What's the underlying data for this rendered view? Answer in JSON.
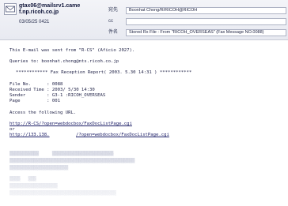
{
  "header": {
    "from_line1": "gtax06@mailsrv1.came",
    "from_line2": "f.np.ricoh.co.jp",
    "date": "03/05/25 0421",
    "to_label": "宛先",
    "to_value": "Boonhat Chong/R/RICOH@RICOH",
    "cc_label": "cc",
    "cc_value": "",
    "subject_label": "件名",
    "subject_value": "Stored Rx File : From \"RICOH_OVERSEAS\" (Fax Message NO.0088)"
  },
  "body": {
    "line1": "This E-mail was sent from \"R-CS\" (Aficio 2027).",
    "line2": "Queries to: boonhat.chong@nts.ricoh.co.jp",
    "report_header": "************ Fax Reception Report( 2003. 5.30 14:31 ) ************",
    "file_no": "File No.      : 0088",
    "received_time": "Received Time : 2003/ 5/30 14:30",
    "sender": "Sender        : G3-1 :RICOH_OVERSEAS",
    "page": "Page          : 001",
    "access": "Access the following URL.",
    "url1": "http://R-CS/?open=webdocbox/FaxDocListPage.cgi",
    "or": "or",
    "url2a": "http://133.138.",
    "url2b": "/?open=webdocbox/FaxDocListPage.cgi"
  }
}
